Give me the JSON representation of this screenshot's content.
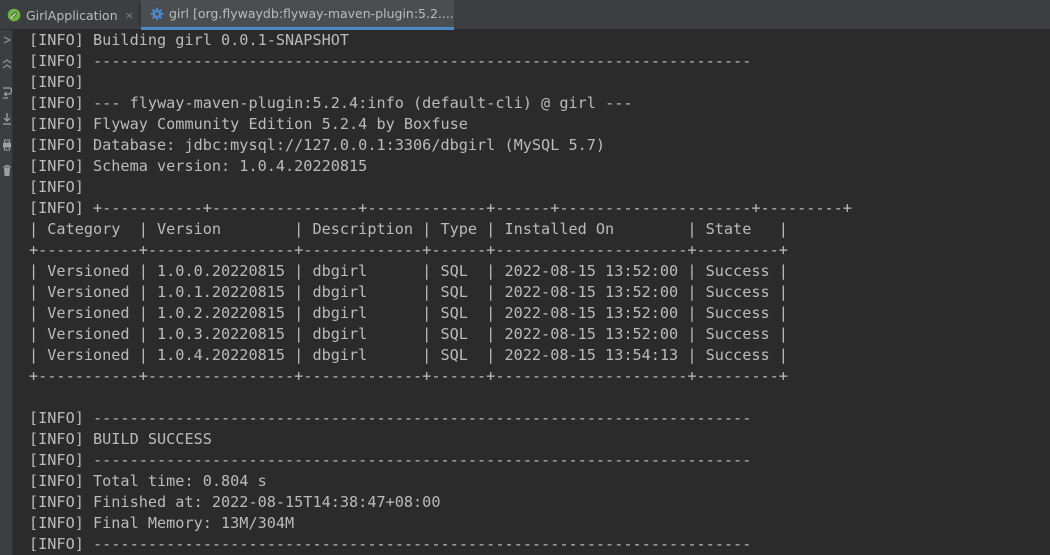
{
  "tabs": [
    {
      "label": "GirlApplication",
      "icon": "spring-leaf-icon",
      "close": "×"
    },
    {
      "label": "girl [org.flywaydb:flyway-maven-plugin:5.2....",
      "icon": "gear-icon",
      "close": "×"
    }
  ],
  "gutter_icons": [
    "rerun-icon",
    "restore-layout-icon",
    "scroll-to-end-icon",
    "print-icon",
    "trash-icon"
  ],
  "console": {
    "lines": [
      "[INFO] Building girl 0.0.1-SNAPSHOT",
      "[INFO] ------------------------------------------------------------------------",
      "[INFO] ",
      "[INFO] --- flyway-maven-plugin:5.2.4:info (default-cli) @ girl ---",
      "[INFO] Flyway Community Edition 5.2.4 by Boxfuse",
      "[INFO] Database: jdbc:mysql://127.0.0.1:3306/dbgirl (MySQL 5.7)",
      "[INFO] Schema version: 1.0.4.20220815",
      "[INFO] ",
      "[INFO] +-----------+----------------+-------------+------+---------------------+---------+",
      "| Category  | Version        | Description | Type | Installed On        | State   |",
      "+-----------+----------------+-------------+------+---------------------+---------+",
      "| Versioned | 1.0.0.20220815 | dbgirl      | SQL  | 2022-08-15 13:52:00 | Success |",
      "| Versioned | 1.0.1.20220815 | dbgirl      | SQL  | 2022-08-15 13:52:00 | Success |",
      "| Versioned | 1.0.2.20220815 | dbgirl      | SQL  | 2022-08-15 13:52:00 | Success |",
      "| Versioned | 1.0.3.20220815 | dbgirl      | SQL  | 2022-08-15 13:52:00 | Success |",
      "| Versioned | 1.0.4.20220815 | dbgirl      | SQL  | 2022-08-15 13:54:13 | Success |",
      "+-----------+----------------+-------------+------+---------------------+---------+",
      "",
      "[INFO] ------------------------------------------------------------------------",
      "[INFO] BUILD SUCCESS",
      "[INFO] ------------------------------------------------------------------------",
      "[INFO] Total time: 0.804 s",
      "[INFO] Finished at: 2022-08-15T14:38:47+08:00",
      "[INFO] Final Memory: 13M/304M",
      "[INFO] ------------------------------------------------------------------------"
    ]
  },
  "colors": {
    "console_bg": "#2b2b2b",
    "console_text": "#bbbbbb",
    "tab_active_underline": "#4a88c7",
    "spring_green": "#6db33f"
  }
}
